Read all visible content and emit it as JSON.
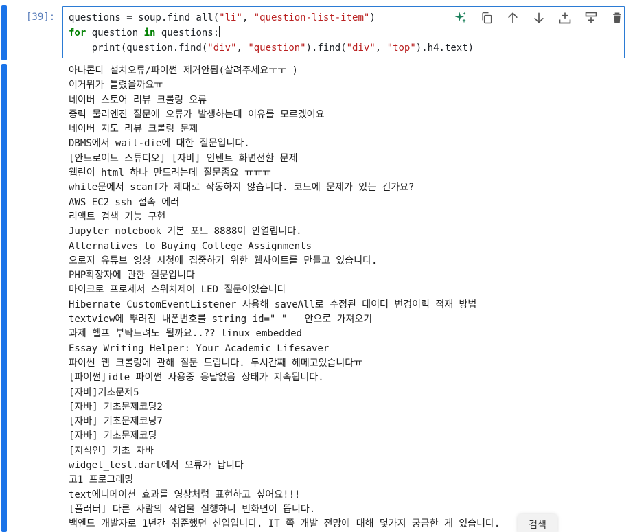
{
  "cell": {
    "prompt": "[39]:",
    "code": {
      "l1_a": "questions = soup.find_all(",
      "l1_s1": "\"li\"",
      "l1_b": ", ",
      "l1_s2": "\"question-list-item\"",
      "l1_c": ")",
      "l2_kw1": "for",
      "l2_a": " question ",
      "l2_kw2": "in",
      "l2_b": " questions:",
      "l3_a": "    print(question.find(",
      "l3_s1": "\"div\"",
      "l3_b": ", ",
      "l3_s2": "\"question\"",
      "l3_c": ").find(",
      "l3_s3": "\"div\"",
      "l3_d": ", ",
      "l3_s4": "\"top\"",
      "l3_e": ").h4.text)"
    },
    "toolbar": [
      {
        "name": "ai-assist-icon"
      },
      {
        "name": "duplicate-cell-icon"
      },
      {
        "name": "move-up-icon"
      },
      {
        "name": "move-down-icon"
      },
      {
        "name": "insert-below-icon"
      },
      {
        "name": "insert-above-icon"
      },
      {
        "name": "delete-cell-icon"
      }
    ],
    "accent_color": "#1a73e8"
  },
  "output": {
    "lines": [
      "아나콘다 설치오류/파이썬 제거안됨(살려주세요ㅜㅜ )",
      "이거뭐가 틀렸을까요ㅠ",
      "네이버 스토어 리뷰 크롤링 오류",
      "중력 물리엔진 질문에 오류가 발생하는데 이유를 모르겠어요",
      "네이버 지도 리뷰 크롤링 문제",
      "DBMS에서 wait-die에 대한 질문입니다.",
      "[안드로이드 스튜디오] [자바] 인텐트 화면전환 문제",
      "웹린이 html 하나 만드려는데 질문좀요 ㅠㅠㅠ",
      "while문에서 scanf가 제대로 작동하지 않습니다. 코드에 문제가 있는 건가요?",
      "AWS EC2 ssh 접속 에러",
      "리액트 검색 기능 구현",
      "Jupyter notebook 기본 포트 8888이 안열립니다.",
      "Alternatives to Buying College Assignments",
      "오로지 유튜브 영상 시청에 집중하기 위한 웹사이트를 만들고 있습니다.",
      "PHP확장자에 관한 질문입니다",
      "마이크로 프로세서 스위치제어 LED 질문이있습니다",
      "Hibernate CustomEventListener 사용해 saveAll로 수정된 데이터 변경이력 적재 방법",
      "textview에 뿌려진 내폰번호를 string id=\" \"   안으로 가져오기",
      "과제 헬프 부탁드려도 될까요..?? linux embedded",
      "Essay Writing Helper: Your Academic Lifesaver",
      "파이썬 웹 크롤링에 관해 질문 드립니다. 두시간째 헤메고있습니다ㅠ",
      "[파이썬]idle 파이썬 사용중 응답없음 상태가 지속됩니다.",
      "[자바]기초문제5",
      "[자바] 기초문제코딩2",
      "[자바] 기초문제코딩7",
      "[자바] 기초문제코딩",
      "[지식인] 기초 자바",
      "widget_test.dart에서 오류가 납니다",
      "고1 프로그래밍",
      "text에니메이션 효과를 영상처럼 표현하고 싶어요!!!",
      "[플러터] 다른 사람의 작업물 실행하니 빈화면이 뜹니다.",
      "백엔드 개발자로 1년간 취준했던 신입입니다. IT 쪽 개발 전망에 대해 몇가지 궁금한 게 있습니다."
    ]
  },
  "search_chip": "검색"
}
